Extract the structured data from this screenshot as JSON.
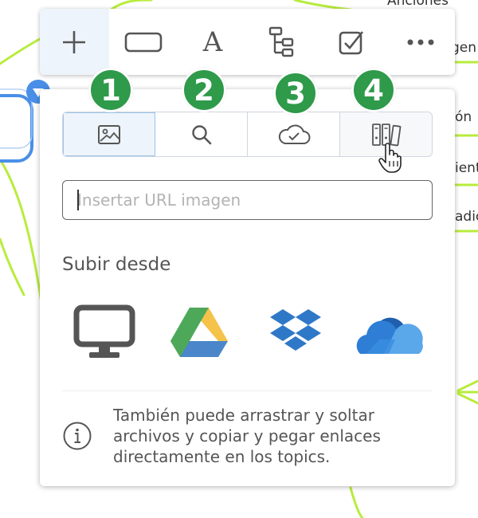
{
  "background": {
    "labels": [
      "Anciones",
      "gen",
      "ón",
      "ient",
      "adic"
    ]
  },
  "toolbar": {
    "items": [
      {
        "name": "add",
        "icon": "plus-icon"
      },
      {
        "name": "topic",
        "icon": "rectangle-icon"
      },
      {
        "name": "text",
        "icon": "text-a-icon",
        "glyph": "A"
      },
      {
        "name": "structure",
        "icon": "tree-structure-icon"
      },
      {
        "name": "task",
        "icon": "checkbox-icon"
      },
      {
        "name": "more",
        "icon": "more-dots-icon"
      }
    ]
  },
  "badges": [
    "1",
    "2",
    "3",
    "4"
  ],
  "tabs": [
    {
      "name": "image",
      "icon": "image-icon",
      "state": "selected"
    },
    {
      "name": "search",
      "icon": "search-icon"
    },
    {
      "name": "cloud",
      "icon": "cloud-check-icon"
    },
    {
      "name": "library",
      "icon": "library-binders-icon",
      "state": "hovered"
    }
  ],
  "url_input": {
    "placeholder": "Insertar URL imagen",
    "value": ""
  },
  "upload": {
    "title": "Subir desde",
    "sources": [
      {
        "name": "computer",
        "icon": "monitor-icon"
      },
      {
        "name": "google-drive",
        "icon": "google-drive-icon"
      },
      {
        "name": "dropbox",
        "icon": "dropbox-icon"
      },
      {
        "name": "onedrive",
        "icon": "onedrive-icon"
      }
    ]
  },
  "info": {
    "icon": "info-icon",
    "text": "También puede arrastrar y soltar archivos y copiar y pegar enlaces directamente en los topics."
  },
  "colors": {
    "badge": "#2e9a4a",
    "mindmap_line": "#b8ec3c",
    "selected_tab": "#eef4fb",
    "topic_border": "#4a8fe7"
  }
}
